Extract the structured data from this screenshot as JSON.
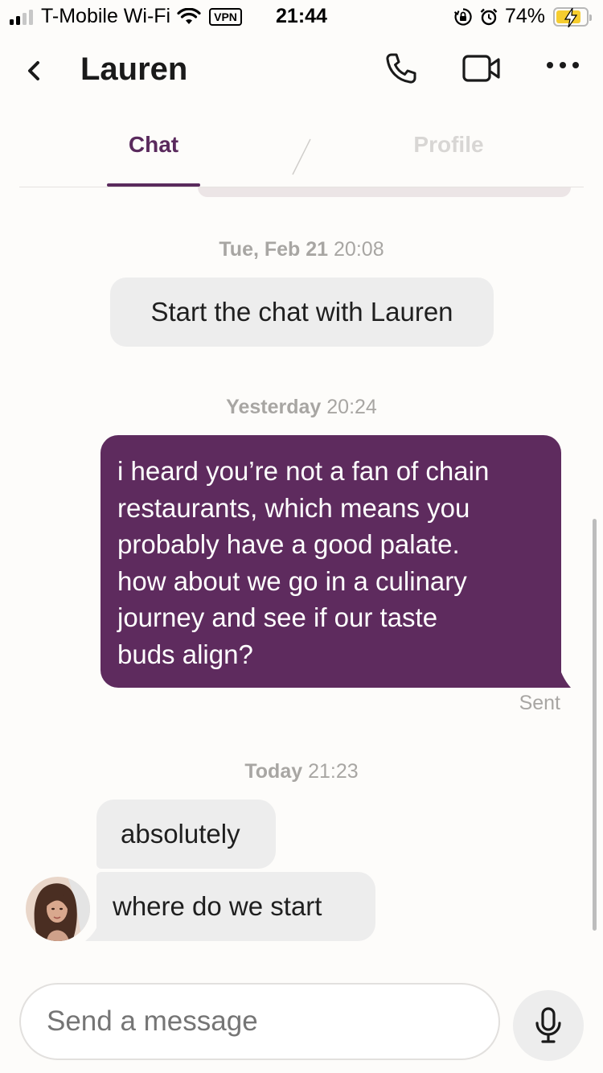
{
  "status_bar": {
    "carrier": "T-Mobile Wi-Fi",
    "vpn": "VPN",
    "time": "21:44",
    "battery_percent": "74%",
    "battery_level": 0.74,
    "icons": [
      "signal-icon",
      "wifi-icon",
      "orientation-lock-icon",
      "alarm-icon",
      "battery-charging-icon"
    ]
  },
  "header": {
    "contact_name": "Lauren",
    "icons": [
      "back-chevron-icon",
      "phone-icon",
      "video-camera-icon",
      "more-dots-icon"
    ]
  },
  "tabs": [
    {
      "label": "Chat",
      "active": true
    },
    {
      "label": "Profile",
      "active": false
    }
  ],
  "messages": {
    "ts1_day": "Tue, Feb 21",
    "ts1_time": "20:08",
    "system_text": "Start the chat with Lauren",
    "ts2_day": "Yesterday",
    "ts2_time": "20:24",
    "sent_lines": [
      "i heard you’re not a fan of chain",
      "restaurants, which means you",
      "probably have a good palate.",
      "how about we go in a culinary",
      "journey and see if our taste",
      "buds align?"
    ],
    "sent_status": "Sent",
    "ts3_day": "Today",
    "ts3_time": "21:23",
    "received_1": "absolutely",
    "received_2": "where do we start"
  },
  "composer": {
    "placeholder": "Send a message",
    "value": ""
  },
  "colors": {
    "accent": "#5a2a5d",
    "sent_bubble": "#5e2b5e",
    "received_bubble": "#ededed",
    "timestamp_gray": "#a8a6a3"
  }
}
